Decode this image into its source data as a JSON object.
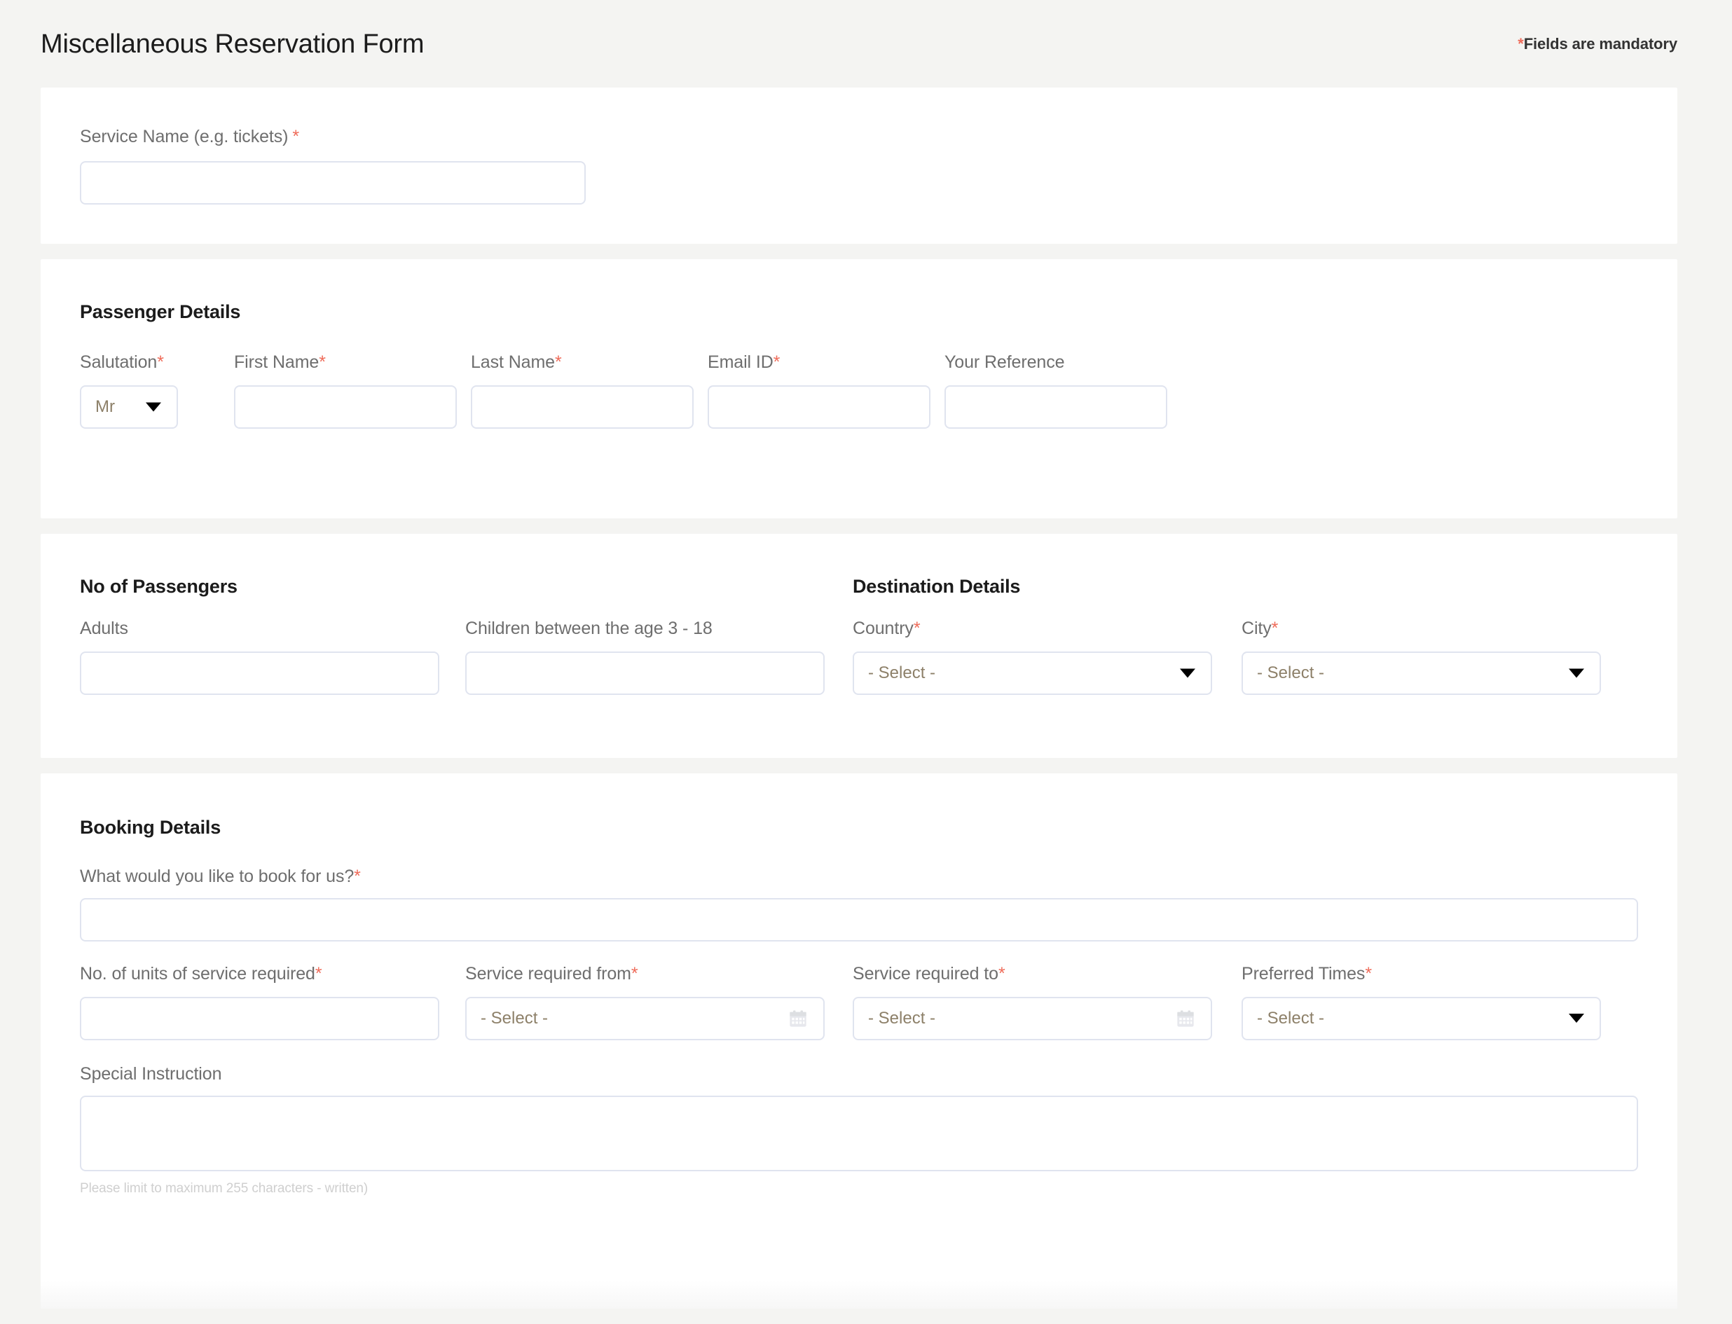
{
  "header": {
    "title": "Miscellaneous Reservation Form",
    "mandatory_star": "*",
    "mandatory_note": "Fields are mandatory"
  },
  "colors": {
    "page_background": "#f4f4f2",
    "card_background": "#ffffff",
    "required_asterisk": "#ef6c5a",
    "label_text": "#6e6e6e",
    "heading_text": "#1b1b1b",
    "input_border": "#e0e4ef",
    "select_value_text": "#8d8069",
    "helper_text": "#cfcfcf"
  },
  "service_section": {
    "label": "Service Name (e.g. tickets)",
    "required_mark": "*",
    "value": "",
    "placeholder": ""
  },
  "passenger_section": {
    "title": "Passenger Details",
    "fields": [
      {
        "label": "Salutation",
        "required_mark": "*",
        "type": "select",
        "value": "Mr",
        "icon": "chevron-down-icon"
      },
      {
        "label": "First Name",
        "required_mark": "*",
        "type": "text",
        "value": "",
        "placeholder": ""
      },
      {
        "label": "Last Name",
        "required_mark": "*",
        "type": "text",
        "value": "",
        "placeholder": ""
      },
      {
        "label": "Email ID",
        "required_mark": "*",
        "type": "text",
        "value": "",
        "placeholder": ""
      },
      {
        "label": "Your Reference",
        "required_mark": "",
        "type": "text",
        "value": "",
        "placeholder": ""
      }
    ]
  },
  "passengers_section": {
    "title": "No of Passengers",
    "fields": [
      {
        "label": "Adults",
        "required_mark": "",
        "type": "text",
        "value": "",
        "placeholder": ""
      },
      {
        "label": "Children between the age 3 - 18",
        "required_mark": "",
        "type": "text",
        "value": "",
        "placeholder": ""
      }
    ]
  },
  "destination_section": {
    "title": "Destination Details",
    "fields": [
      {
        "label": "Country",
        "required_mark": "*",
        "type": "select",
        "value": "- Select -",
        "icon": "chevron-down-icon"
      },
      {
        "label": "City",
        "required_mark": "*",
        "type": "select",
        "value": "- Select -",
        "icon": "chevron-down-icon"
      }
    ]
  },
  "booking_section": {
    "title": "Booking Details",
    "question": {
      "label": "What would you like to book for us?",
      "required_mark": "*",
      "value": "",
      "placeholder": ""
    },
    "fields": [
      {
        "label": "No. of units of service required",
        "required_mark": "*",
        "type": "text",
        "value": "",
        "placeholder": ""
      },
      {
        "label": "Service required from",
        "required_mark": "*",
        "type": "date",
        "value": "- Select -",
        "icon": "calendar-icon"
      },
      {
        "label": "Service required to",
        "required_mark": "*",
        "type": "date",
        "value": "- Select -",
        "icon": "calendar-icon"
      },
      {
        "label": "Preferred Times",
        "required_mark": "*",
        "type": "select",
        "value": "- Select -",
        "icon": "chevron-down-icon"
      }
    ],
    "special_instruction": {
      "label": "Special Instruction",
      "required_mark": "",
      "value": "",
      "placeholder": "",
      "helper": "Please limit to maximum 255 characters - written)"
    }
  }
}
